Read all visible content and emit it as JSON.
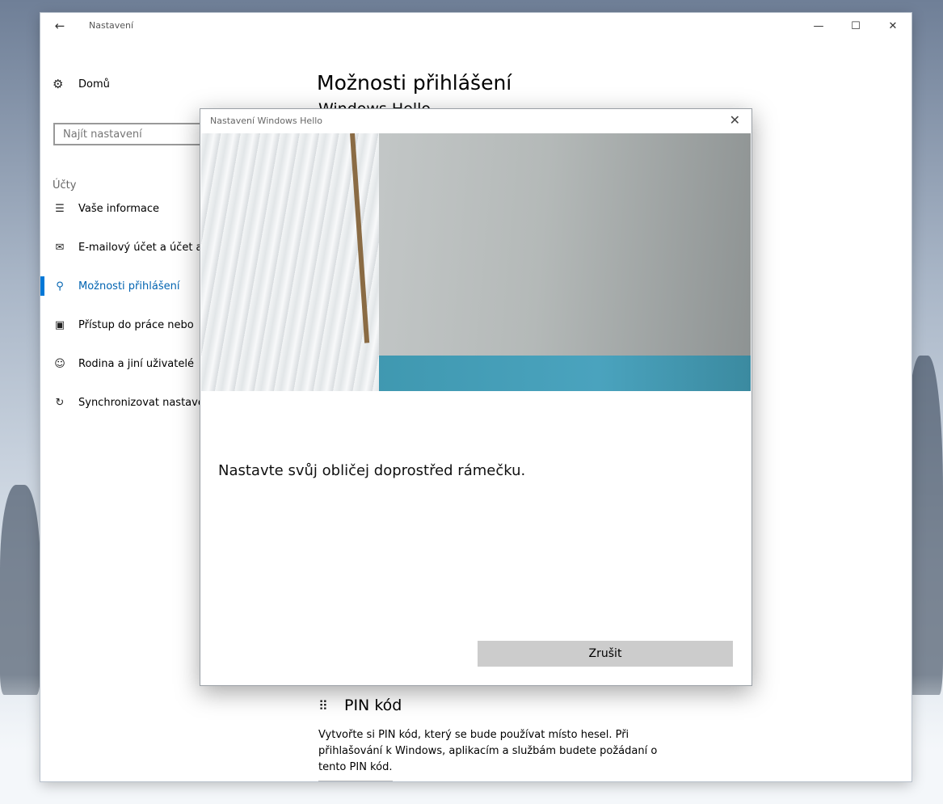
{
  "window": {
    "title": "Nastavení"
  },
  "sidebar": {
    "home_label": "Domů",
    "search_placeholder": "Najít nastavení",
    "section_label": "Účty",
    "items": [
      {
        "label": "Vaše informace",
        "icon": "person-card-icon"
      },
      {
        "label": "E-mailový účet a účet a",
        "icon": "mail-icon"
      },
      {
        "label": "Možnosti přihlášení",
        "icon": "key-icon",
        "active": true
      },
      {
        "label": "Přístup do práce nebo",
        "icon": "briefcase-icon"
      },
      {
        "label": "Rodina a jiní uživatelé",
        "icon": "person-add-icon"
      },
      {
        "label": "Synchronizovat nastave",
        "icon": "sync-icon"
      }
    ]
  },
  "main": {
    "page_title": "Možnosti přihlášení",
    "sub_heading": "Windows Hello",
    "pin": {
      "heading": "PIN kód",
      "description": "Vytvořte si PIN kód, který se bude používat místo hesel. Při přihlašování k Windows, aplikacím a službám budete požádaní o tento PIN kód."
    }
  },
  "dialog": {
    "title": "Nastavení Windows Hello",
    "instruction": "Nastavte svůj obličej doprostřed rámečku.",
    "cancel_label": "Zrušit"
  },
  "colors": {
    "accent": "#0078d7",
    "active_text": "#0063b1",
    "button_bg": "#cccccc"
  }
}
